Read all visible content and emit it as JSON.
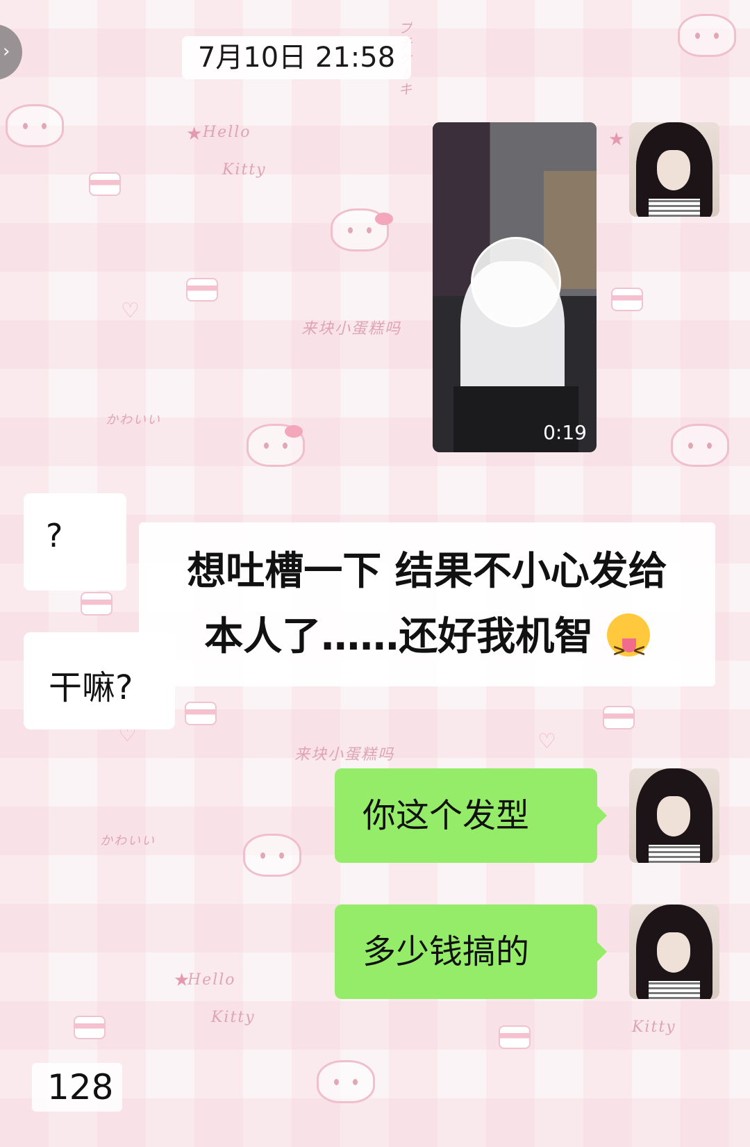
{
  "navigation": {
    "back_icon": "chevron-right-icon"
  },
  "chat": {
    "timestamp": "7月10日 21:58",
    "video_message": {
      "duration": "0:19"
    },
    "incoming": [
      {
        "text": "?"
      },
      {
        "text": "干嘛?"
      }
    ],
    "outgoing": [
      {
        "text": "你这个发型"
      },
      {
        "text": "多少钱搞的"
      }
    ]
  },
  "caption": {
    "line1": "想吐槽一下  结果不小心发给",
    "line2": "本人了……还好我机智",
    "emoji": "squinting-face-with-tongue"
  },
  "background": {
    "decorations": [
      "Hello",
      "Kitty",
      "来块小蛋糕吗",
      "かわいい",
      "プチケーキ"
    ],
    "accent_color": "#f4a6bb"
  },
  "footer": {
    "count": "128"
  },
  "colors": {
    "outgoing_bubble": "#95ec69",
    "incoming_bubble": "#ffffff"
  }
}
